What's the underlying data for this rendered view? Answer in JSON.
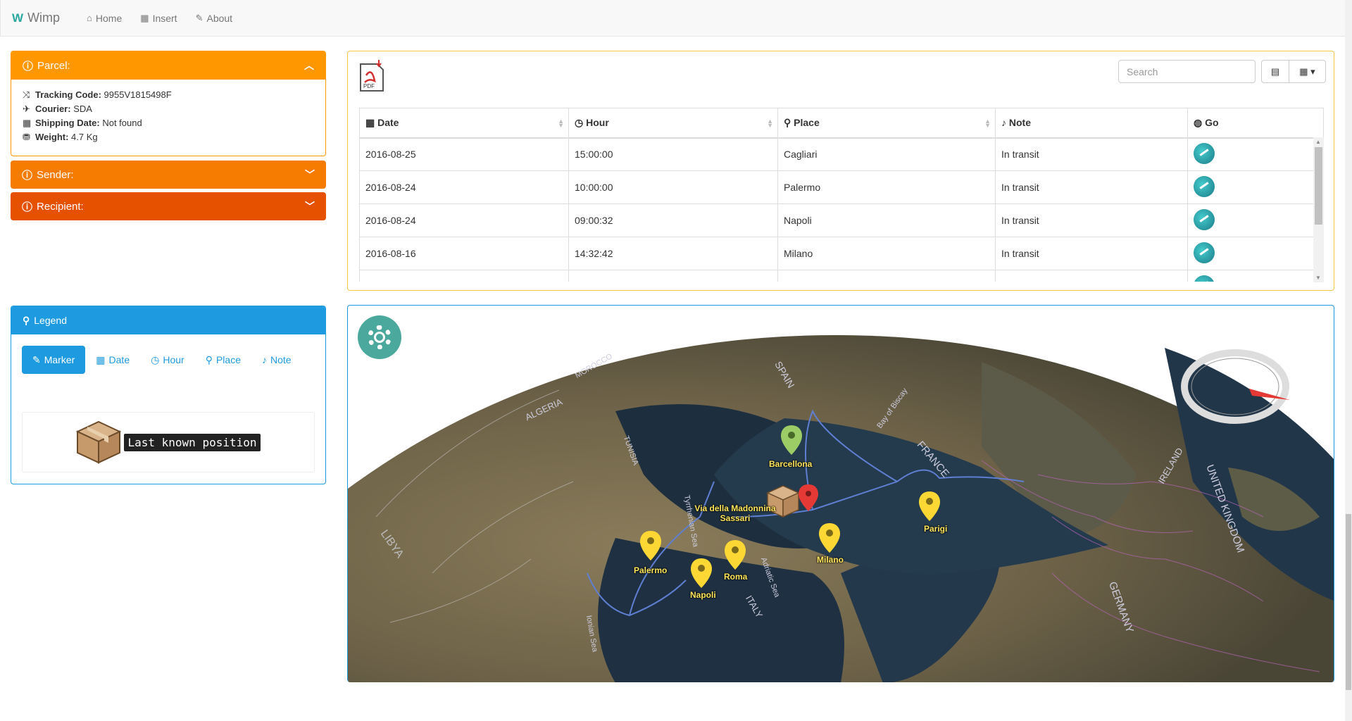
{
  "app": {
    "brand": "Wimp"
  },
  "nav": [
    {
      "label": "Home",
      "icon": "home-icon"
    },
    {
      "label": "Insert",
      "icon": "grid-icon"
    },
    {
      "label": "About",
      "icon": "leaf-icon"
    }
  ],
  "parcel": {
    "title": "Parcel:",
    "fields": [
      {
        "label": "Tracking Code:",
        "value": "9955V1815498F",
        "icon": "shuffle-icon"
      },
      {
        "label": "Courier:",
        "value": "SDA",
        "icon": "plane-icon"
      },
      {
        "label": "Shipping Date:",
        "value": "Not found",
        "icon": "calendar-icon"
      },
      {
        "label": "Weight:",
        "value": "4.7 Kg",
        "icon": "scale-icon"
      }
    ],
    "colors": {
      "accent": "#ff9800"
    }
  },
  "sender": {
    "title": "Sender:",
    "color": "#f57c00"
  },
  "recipient": {
    "title": "Recipient:",
    "color": "#e65100"
  },
  "legend": {
    "title": "Legend",
    "tabs": [
      "Marker",
      "Date",
      "Hour",
      "Place",
      "Note"
    ],
    "active_tab": "Marker",
    "caption": "Last known position"
  },
  "table": {
    "search_placeholder": "Search",
    "columns": [
      "Date",
      "Hour",
      "Place",
      "Note",
      "Go"
    ],
    "rows": [
      {
        "date": "2016-08-25",
        "hour": "15:00:00",
        "place": "Cagliari",
        "note": "In transit"
      },
      {
        "date": "2016-08-24",
        "hour": "10:00:00",
        "place": "Palermo",
        "note": "In transit"
      },
      {
        "date": "2016-08-24",
        "hour": "09:00:32",
        "place": "Napoli",
        "note": "In transit"
      },
      {
        "date": "2016-08-16",
        "hour": "14:32:42",
        "place": "Milano",
        "note": "In transit"
      }
    ]
  },
  "map": {
    "markers": [
      {
        "label": "Barcellona",
        "color": "#9ccc65"
      },
      {
        "label": "Via della Madonnina Sassari",
        "color": "#e53935"
      },
      {
        "label": "Parigi",
        "color": "#fdd835"
      },
      {
        "label": "Milano",
        "color": "#fdd835"
      },
      {
        "label": "Roma",
        "color": "#fdd835"
      },
      {
        "label": "Palermo",
        "color": "#fdd835"
      },
      {
        "label": "Napoli",
        "color": "#fdd835"
      }
    ],
    "region_labels": [
      "LIBYA",
      "TUNISIA",
      "ALGERIA",
      "FRANCE",
      "SPAIN",
      "ITALY",
      "GERMANY",
      "UNITED KINGDOM",
      "IRELAND",
      "MOROCCO",
      "Tyrrhenian Sea",
      "Ionian Sea",
      "Adriatic Sea",
      "Bay of Biscay"
    ]
  }
}
